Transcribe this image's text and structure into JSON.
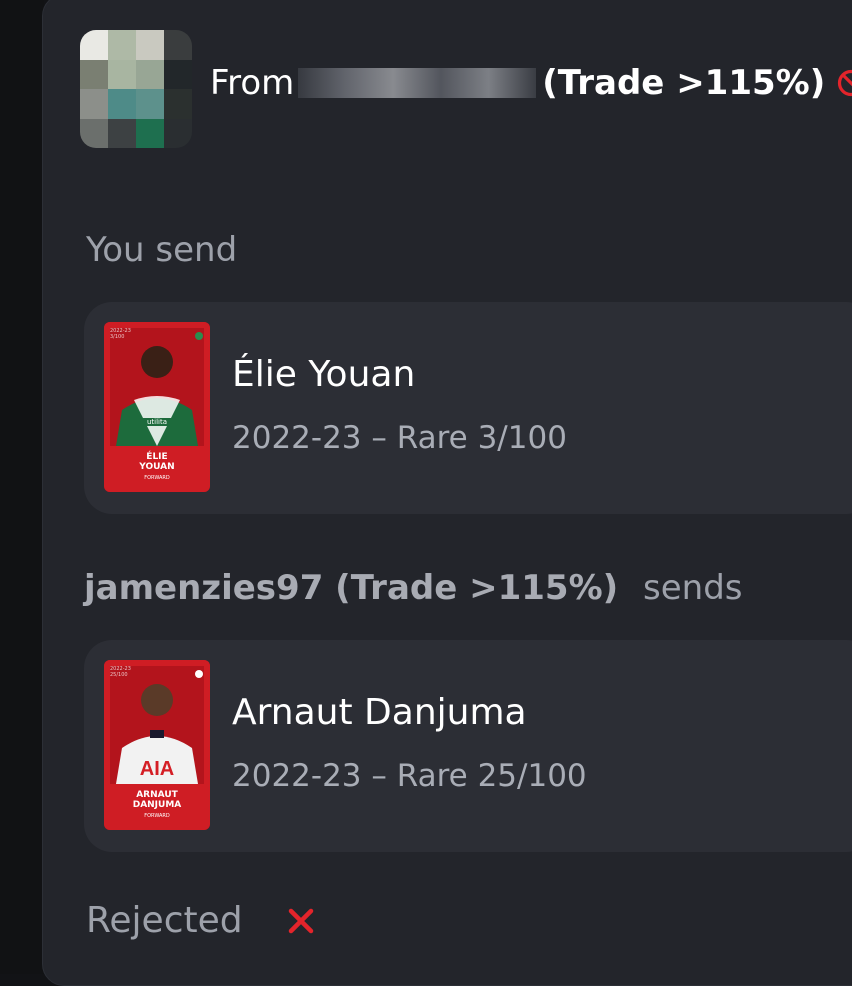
{
  "header": {
    "from_prefix": "From",
    "trade_tag": "(Trade >115%)",
    "blocked_icon": "no-entry-icon"
  },
  "send_section": {
    "label": "You send",
    "card": {
      "player_name": "Élie Youan",
      "detail": "2022-23 – Rare 3/100",
      "card_name_lines": [
        "ÉLIE",
        "YOUAN"
      ],
      "card_position": "FORWARD",
      "card_season": "2022-23",
      "card_serial": "3/100",
      "card_color": "#d41f26"
    }
  },
  "receive_section": {
    "sender": "jamenzies97 (Trade >115%)",
    "verb": "sends",
    "card": {
      "player_name": "Arnaut Danjuma",
      "detail": "2022-23 – Rare 25/100",
      "card_name_lines": [
        "ARNAUT",
        "DANJUMA"
      ],
      "card_position": "FORWARD",
      "card_season": "2022-23",
      "card_serial": "25/100",
      "sponsor": "AIA",
      "card_color": "#d41f26"
    }
  },
  "status": {
    "label": "Rejected",
    "icon": "red-x-icon",
    "icon_color": "#e3242b"
  }
}
